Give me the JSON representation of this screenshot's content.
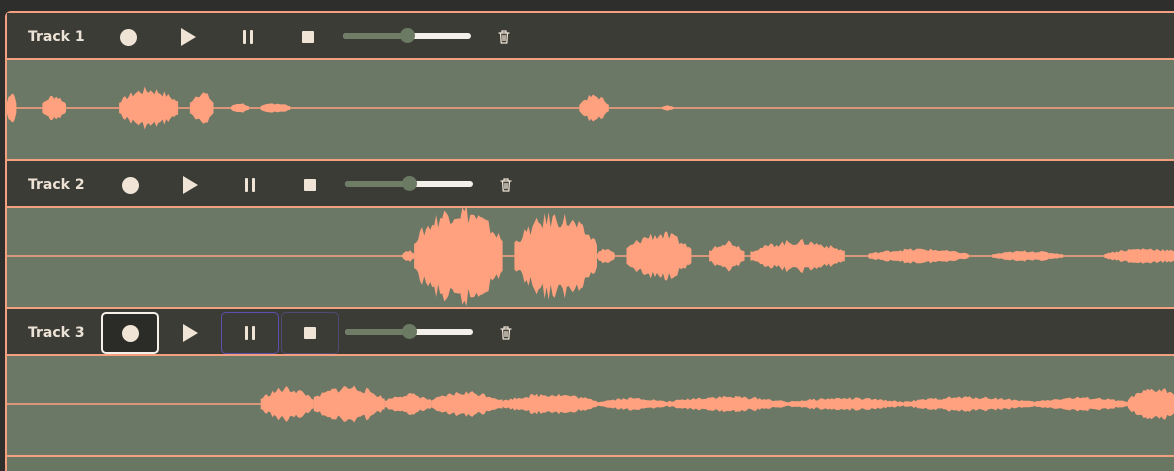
{
  "colors": {
    "accent": "#f2a07f",
    "waveform": "#ffa07f",
    "toolbar": "#3c3c37",
    "lane": "#6b7865",
    "icon": "#efe4d6"
  },
  "controls": {
    "record_icon": "record-icon",
    "play_icon": "play-icon",
    "pause_icon": "pause-icon",
    "stop_icon": "stop-icon",
    "delete_icon": "trash-icon"
  },
  "tracks": [
    {
      "name": "Track 1",
      "volume": 0.5,
      "waveform": [
        {
          "start": 0.0,
          "end": 0.008,
          "amp": 0.35
        },
        {
          "start": 0.03,
          "end": 0.05,
          "amp": 0.25
        },
        {
          "start": 0.095,
          "end": 0.145,
          "amp": 0.38
        },
        {
          "start": 0.155,
          "end": 0.175,
          "amp": 0.32
        },
        {
          "start": 0.19,
          "end": 0.205,
          "amp": 0.1
        },
        {
          "start": 0.215,
          "end": 0.24,
          "amp": 0.1
        },
        {
          "start": 0.485,
          "end": 0.51,
          "amp": 0.25
        },
        {
          "start": 0.555,
          "end": 0.565,
          "amp": 0.05
        }
      ]
    },
    {
      "name": "Track 2",
      "volume": 0.5,
      "waveform": [
        {
          "start": 0.335,
          "end": 0.345,
          "amp": 0.12
        },
        {
          "start": 0.345,
          "end": 0.42,
          "amp": 0.95
        },
        {
          "start": 0.43,
          "end": 0.5,
          "amp": 0.8
        },
        {
          "start": 0.5,
          "end": 0.515,
          "amp": 0.15
        },
        {
          "start": 0.525,
          "end": 0.58,
          "amp": 0.45
        },
        {
          "start": 0.595,
          "end": 0.625,
          "amp": 0.3
        },
        {
          "start": 0.63,
          "end": 0.71,
          "amp": 0.3
        },
        {
          "start": 0.73,
          "end": 0.815,
          "amp": 0.14
        },
        {
          "start": 0.835,
          "end": 0.895,
          "amp": 0.1
        },
        {
          "start": 0.93,
          "end": 1.0,
          "amp": 0.15
        }
      ]
    },
    {
      "name": "Track 3",
      "volume": 0.5,
      "waveform": [
        {
          "start": 0.215,
          "end": 0.26,
          "amp": 0.32
        },
        {
          "start": 0.26,
          "end": 0.32,
          "amp": 0.35
        },
        {
          "start": 0.32,
          "end": 0.36,
          "amp": 0.2
        },
        {
          "start": 0.36,
          "end": 0.42,
          "amp": 0.24
        },
        {
          "start": 0.42,
          "end": 0.5,
          "amp": 0.2
        },
        {
          "start": 0.5,
          "end": 0.56,
          "amp": 0.12
        },
        {
          "start": 0.56,
          "end": 0.66,
          "amp": 0.15
        },
        {
          "start": 0.66,
          "end": 0.76,
          "amp": 0.12
        },
        {
          "start": 0.76,
          "end": 0.87,
          "amp": 0.14
        },
        {
          "start": 0.87,
          "end": 0.95,
          "amp": 0.13
        },
        {
          "start": 0.95,
          "end": 1.0,
          "amp": 0.3
        }
      ]
    }
  ]
}
